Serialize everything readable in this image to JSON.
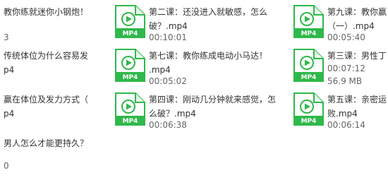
{
  "file_icon_label": "MP4",
  "colors": {
    "accent": "#2fb84b",
    "text": "#333333",
    "meta": "#666666"
  },
  "items": [
    {
      "line1": "教你练就迷你小钢炮！",
      "line2": "",
      "meta": "3"
    },
    {
      "line1": "第二课：还没进入就敏感，怎么",
      "line2": "破？.mp4",
      "meta": "00:10:01"
    },
    {
      "line1": "第九课：教你赢",
      "line2": "（一）.mp4",
      "meta": "00:05:40"
    },
    {
      "line1": "传统体位为什么容易发",
      "line2": "p4",
      "meta": ""
    },
    {
      "line1": "第七课：教你练成电动小马达！",
      "line2": ".mp4",
      "meta": "00:05:02"
    },
    {
      "line1": "第三课：男性丁",
      "line2": "00:07:12",
      "meta": "56.9 MB"
    },
    {
      "line1": "赢在体位及发力方式（",
      "line2": "p4",
      "meta": ""
    },
    {
      "line1": "第四课：刚动几分钟就来感觉，怎",
      "line2": "么破？.mp4",
      "meta": "00:06:38"
    },
    {
      "line1": "第五课：亲密运",
      "line2": "败.mp4",
      "meta": "00:06:14"
    },
    {
      "line1": "男人怎么才能更持久？",
      "line2": "",
      "meta": "0"
    }
  ]
}
